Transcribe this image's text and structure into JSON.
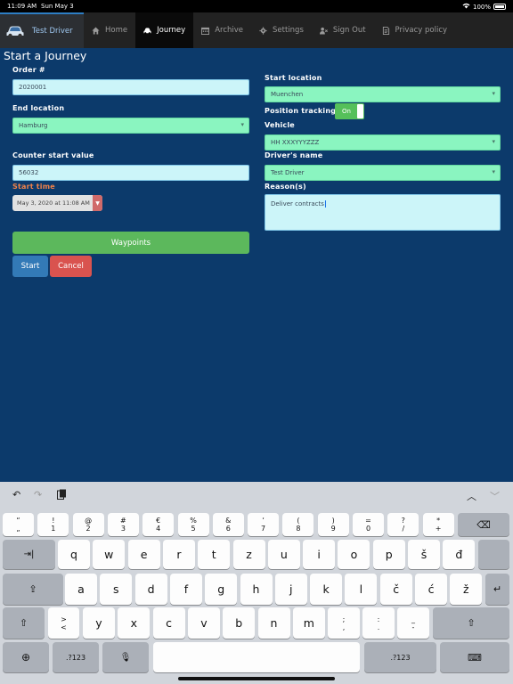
{
  "status": {
    "time": "11:09 AM",
    "date": "Sun May 3",
    "battery": "100%"
  },
  "nav": {
    "brand": "Test Driver",
    "items": [
      {
        "label": "Home",
        "icon": "home-icon"
      },
      {
        "label": "Journey",
        "icon": "car-icon",
        "active": true
      },
      {
        "label": "Archive",
        "icon": "calendar-icon"
      },
      {
        "label": "Settings",
        "icon": "gear-icon"
      },
      {
        "label": "Sign Out",
        "icon": "user-x-icon"
      },
      {
        "label": "Privacy policy",
        "icon": "document-icon"
      }
    ]
  },
  "form": {
    "title": "Start a Journey",
    "order_label": "Order #",
    "order_value": "2020001",
    "end_location_label": "End location",
    "end_location_value": "Hamburg",
    "counter_label": "Counter start value",
    "counter_value": "56032",
    "start_time_label": "Start time",
    "start_time_value": "May 3, 2020 at 11:08 AM",
    "start_location_label": "Start location",
    "start_location_value": "Muenchen",
    "position_tracking_label": "Position tracking",
    "position_tracking_value": "On",
    "vehicle_label": "Vehicle",
    "vehicle_value": "HH XXXYYYZZZ",
    "driver_label": "Driver's name",
    "driver_value": "Test Driver",
    "reason_label": "Reason(s)",
    "reason_value": "Deliver contracts",
    "waypoints_button": "Waypoints",
    "start_button": "Start",
    "cancel_button": "Cancel"
  },
  "keyboard": {
    "number_row": [
      {
        "top": "“",
        "bottom": "„"
      },
      {
        "top": "!",
        "bottom": "1"
      },
      {
        "top": "@",
        "bottom": "2"
      },
      {
        "top": "#",
        "bottom": "3"
      },
      {
        "top": "€",
        "bottom": "4"
      },
      {
        "top": "%",
        "bottom": "5"
      },
      {
        "top": "&",
        "bottom": "6"
      },
      {
        "top": "‘",
        "bottom": "7"
      },
      {
        "top": "(",
        "bottom": "8"
      },
      {
        "top": ")",
        "bottom": "9"
      },
      {
        "top": "=",
        "bottom": "0"
      },
      {
        "top": "?",
        "bottom": "/"
      },
      {
        "top": "*",
        "bottom": "+"
      }
    ],
    "row1": [
      "q",
      "w",
      "e",
      "r",
      "t",
      "z",
      "u",
      "i",
      "o",
      "p",
      "š",
      "đ"
    ],
    "row2": [
      "a",
      "s",
      "d",
      "f",
      "g",
      "h",
      "j",
      "k",
      "l",
      "č",
      "ć",
      "ž"
    ],
    "row3": [
      "y",
      "x",
      "c",
      "v",
      "b",
      "n",
      "m"
    ],
    "row3_punct": [
      {
        "top": ">",
        "bottom": "<"
      },
      {
        "top": ";",
        "bottom": ","
      },
      {
        "top": ":",
        "bottom": "."
      },
      {
        "top": "_",
        "bottom": "-"
      }
    ],
    "numbers_key": ".?123"
  }
}
